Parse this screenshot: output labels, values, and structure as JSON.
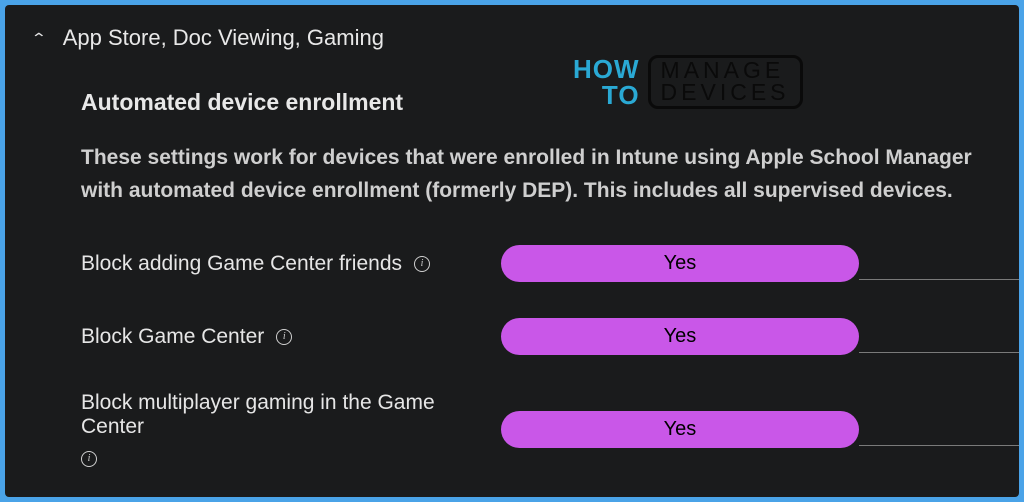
{
  "section": {
    "title": "App Store, Doc Viewing, Gaming"
  },
  "watermark": {
    "how": "HOW",
    "to": "TO",
    "manage": "MANAGE",
    "devices": "DEVICES"
  },
  "subsection": {
    "title": "Automated device enrollment",
    "description": "These settings work for devices that were enrolled in Intune using Apple School Manager with automated device enrollment (formerly DEP). This includes all supervised devices."
  },
  "settings": [
    {
      "label": "Block adding Game Center friends",
      "value": "Yes"
    },
    {
      "label": "Block Game Center",
      "value": "Yes"
    },
    {
      "label": "Block multiplayer gaming in the Game Center",
      "value": "Yes"
    }
  ]
}
